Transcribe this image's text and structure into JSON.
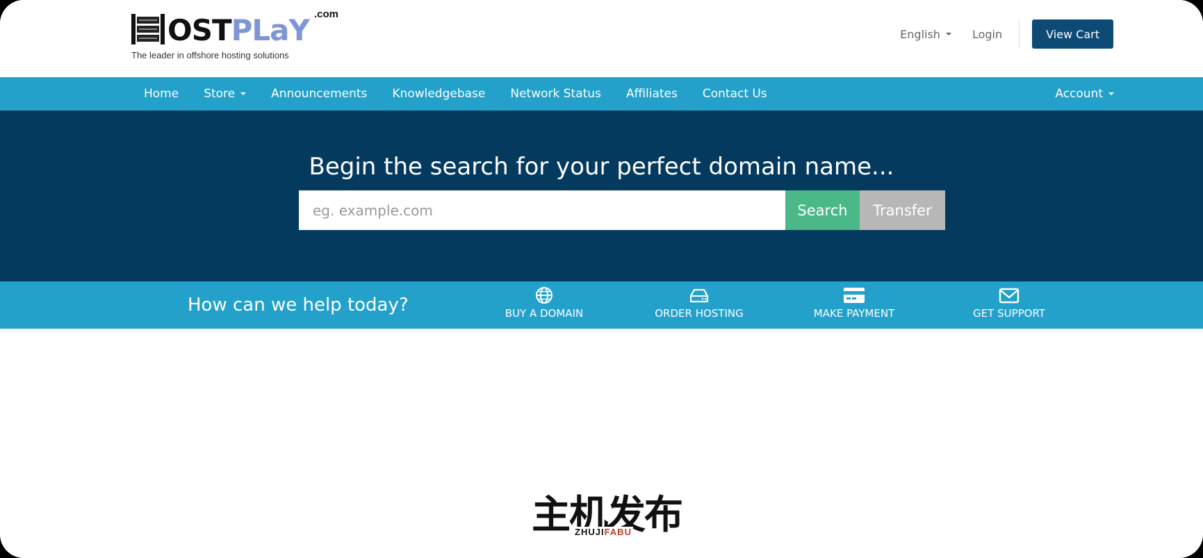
{
  "brand": {
    "name_part1": "OST",
    "name_part2": "PLaY",
    "domain_suffix": ".com",
    "tagline": "The leader in offshore hosting solutions"
  },
  "header": {
    "language": "English",
    "login": "Login",
    "cart_button": "View Cart"
  },
  "nav": {
    "items": [
      {
        "label": "Home"
      },
      {
        "label": "Store",
        "dropdown": true
      },
      {
        "label": "Announcements"
      },
      {
        "label": "Knowledgebase"
      },
      {
        "label": "Network Status"
      },
      {
        "label": "Affiliates"
      },
      {
        "label": "Contact Us"
      }
    ],
    "account": "Account"
  },
  "hero": {
    "title": "Begin the search for your perfect domain name...",
    "placeholder": "eg. example.com",
    "search_button": "Search",
    "transfer_button": "Transfer"
  },
  "help": {
    "prompt": "How can we help today?",
    "actions": [
      {
        "label": "BUY A DOMAIN",
        "icon": "globe-icon"
      },
      {
        "label": "ORDER HOSTING",
        "icon": "server-icon"
      },
      {
        "label": "MAKE PAYMENT",
        "icon": "credit-card-icon"
      },
      {
        "label": "GET SUPPORT",
        "icon": "envelope-icon"
      }
    ]
  },
  "watermark": {
    "chinese": "主机发布",
    "latin_part1": "ZHUJI",
    "latin_part2": "FABU"
  },
  "colors": {
    "navbar": "#23a1cb",
    "hero": "#053a5f",
    "cart_button": "#0d4a75",
    "search_button": "#4bb887",
    "transfer_button": "#b7b7b7"
  }
}
